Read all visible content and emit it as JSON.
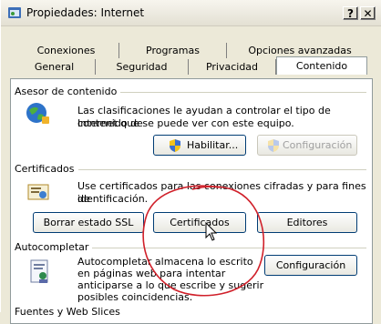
{
  "window": {
    "title": "Propiedades: Internet",
    "help_label": "?",
    "close_label": "✕"
  },
  "tabs_back": [
    "Conexiones",
    "Programas",
    "Opciones avanzadas"
  ],
  "tabs_front": [
    "General",
    "Seguridad",
    "Privacidad",
    "Contenido"
  ],
  "advisor": {
    "title": "Asesor de contenido",
    "description_line1": "Las clasificaciones le ayudan a controlar el tipo de contenido de",
    "description_line2": "Internet que se puede ver con este equipo.",
    "enable_label": "Habilitar...",
    "config_label": "Configuración"
  },
  "certificates": {
    "title": "Certificados",
    "description_line1": "Use certificados para las conexiones cifradas y para fines de",
    "description_line2": "identificación.",
    "clear_ssl_label": "Borrar estado SSL",
    "certificates_label": "Certificados",
    "publishers_label": "Editores"
  },
  "autocomplete": {
    "title": "Autocompletar",
    "line1": "Autocompletar almacena lo escrito",
    "line2": "en páginas web para intentar",
    "line3": "anticiparse a lo que escribe y sugerir",
    "line4": "posibles coincidencias.",
    "config_label": "Configuración"
  },
  "feeds": {
    "title": "Fuentes y Web Slices"
  },
  "colors": {
    "annotation": "#d0202a",
    "titlebar_bg": "#eeece3",
    "panel_bg": "#ffffff"
  }
}
